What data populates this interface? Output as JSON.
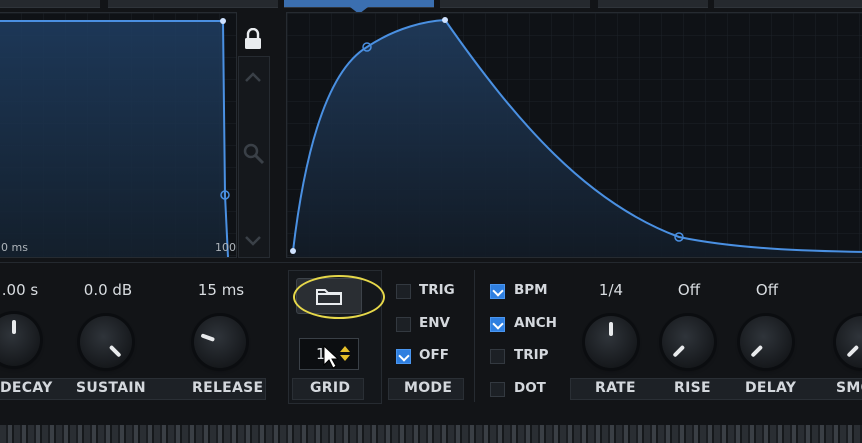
{
  "left_graph": {
    "time_label": "0 ms",
    "end_label": "100"
  },
  "controls": {
    "decay": {
      "value": ".00 s",
      "label": "DECAY"
    },
    "sustain": {
      "value": "0.0 dB",
      "label": "SUSTAIN"
    },
    "release": {
      "value": "15 ms",
      "label": "RELEASE"
    },
    "rate": {
      "value": "1/4",
      "label": "RATE"
    },
    "rise": {
      "value": "Off",
      "label": "RISE"
    },
    "delay": {
      "value": "Off",
      "label": "DELAY"
    },
    "smooth": {
      "label": "SMO"
    }
  },
  "grid": {
    "value": "1",
    "label": "GRID"
  },
  "mode": {
    "label": "MODE",
    "options": [
      {
        "label": "TRIG",
        "checked": false
      },
      {
        "label": "ENV",
        "checked": false
      },
      {
        "label": "OFF",
        "checked": true
      }
    ]
  },
  "flags": [
    {
      "label": "BPM",
      "checked": true
    },
    {
      "label": "ANCH",
      "checked": true
    },
    {
      "label": "TRIP",
      "checked": false
    },
    {
      "label": "DOT",
      "checked": false
    }
  ],
  "colors": {
    "accent": "#3a8ef0",
    "curve": "#4a90e2",
    "highlight": "#e6d84a"
  },
  "icons": {
    "lock": "lock-icon",
    "folder": "folder-icon",
    "zoom": "magnifier-icon"
  }
}
